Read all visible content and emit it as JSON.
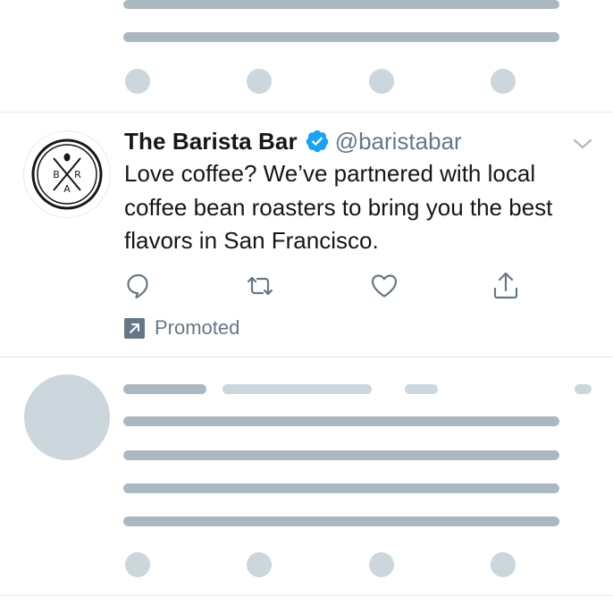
{
  "tweet": {
    "display_name": "The Barista Bar",
    "handle": "@baristabar",
    "text": "Love coffee? We’ve partnered with local coffee bean roasters to bring you the best flavors in San Francisco.",
    "promoted_label": "Promoted",
    "avatar_logo_letters": "BAR",
    "icons": {
      "verified": "verified-badge-icon",
      "menu": "chevron-down-icon",
      "reply": "reply-icon",
      "retweet": "retweet-icon",
      "like": "heart-icon",
      "share": "share-icon",
      "promoted": "promoted-arrow-icon"
    }
  },
  "colors": {
    "accent": "#1da1f2",
    "text_primary": "#14171a",
    "text_secondary": "#657786",
    "skeleton_dark": "#aab8c2",
    "skeleton_light": "#ccd6dd",
    "divider": "#e1e8ed"
  }
}
